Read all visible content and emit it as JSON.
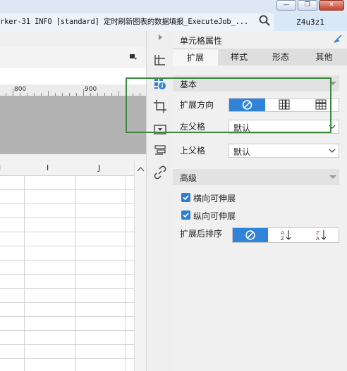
{
  "window": {
    "log_title": "rker-31 INFO [standard] 定时刷新图表的数据填报_ExecuteJob_...",
    "user": "Z4u3z1",
    "buttons": {
      "minimize": "—",
      "restore": "❐",
      "close": "✕"
    }
  },
  "ruler": {
    "labels": [
      "800",
      "900"
    ]
  },
  "columns": [
    "I",
    "J"
  ],
  "column_partial": "I",
  "panel": {
    "title": "单元格属性",
    "tabs": [
      "扩展",
      "样式",
      "形态",
      "其他"
    ],
    "active_tab": "扩展",
    "basic": {
      "header": "基本",
      "direction_label": "扩展方向",
      "left_parent_label": "左父格",
      "left_parent_value": "默认",
      "top_parent_label": "上父格",
      "top_parent_value": "默认"
    },
    "advanced": {
      "header": "高级",
      "horizontal_label": "横向可伸展",
      "vertical_label": "纵向可伸展",
      "sort_label": "扩展后排序"
    }
  },
  "colors": {
    "accent": "#2f83d8",
    "highlight": "#3b8a3b",
    "checkbox": "#2b7fd3"
  },
  "icons": [
    "search-icon",
    "pin-icon",
    "cell-attr-icon",
    "crop-icon",
    "widget-icon",
    "link-icon"
  ]
}
